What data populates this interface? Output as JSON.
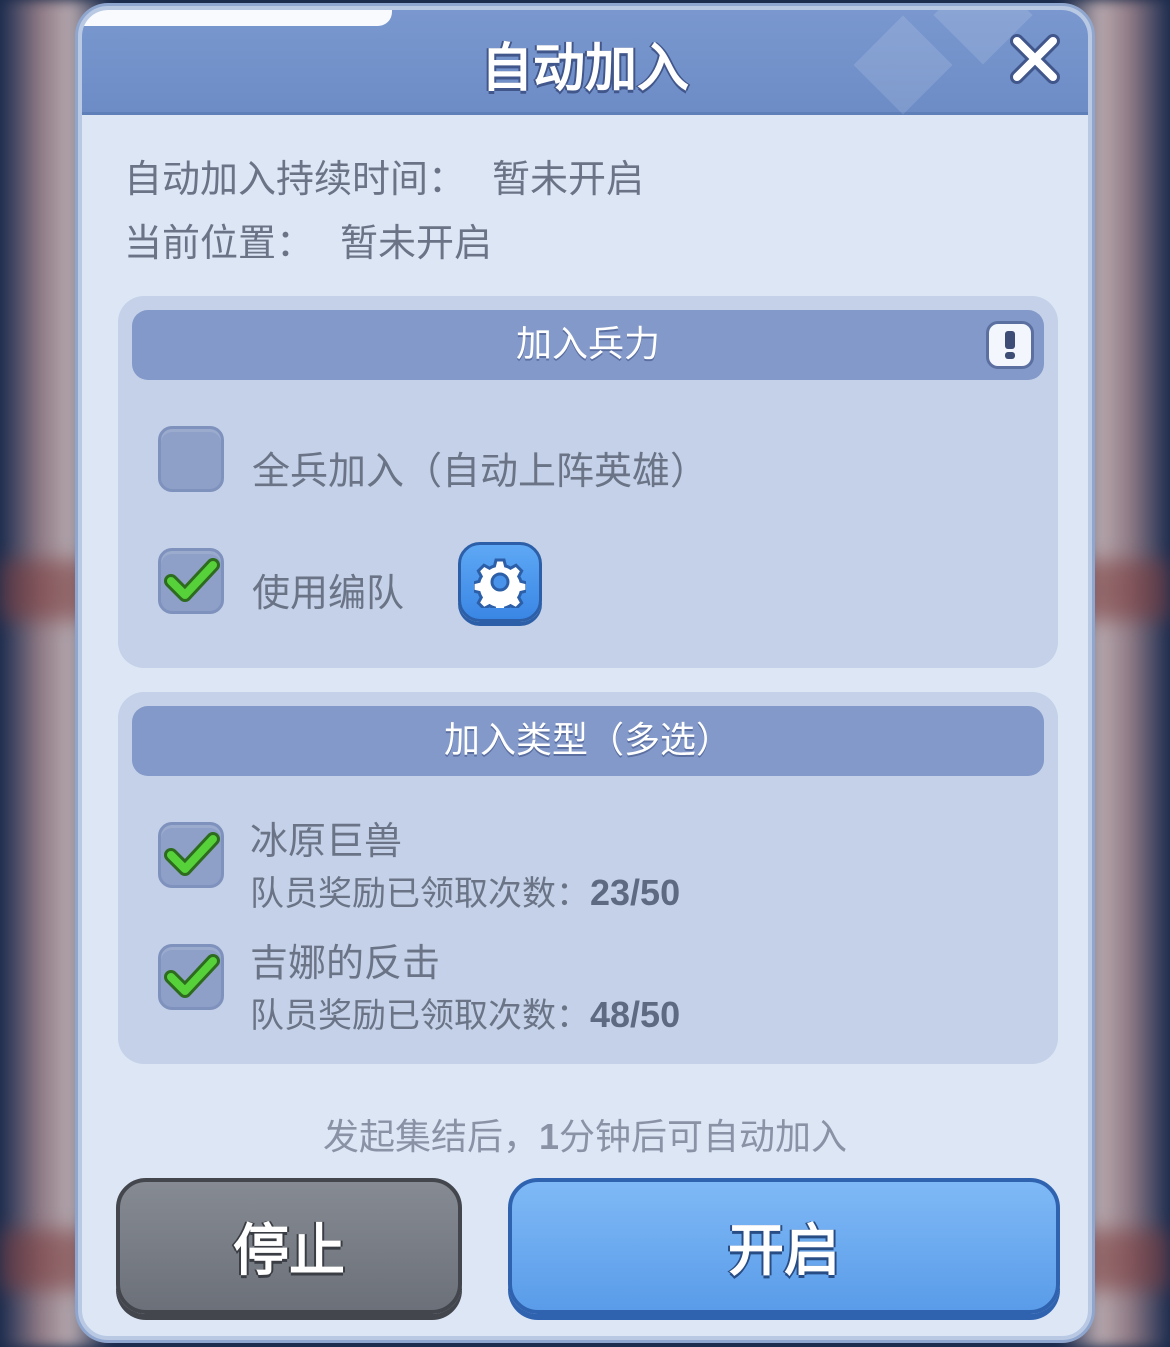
{
  "dialog": {
    "title": "自动加入",
    "close_icon": "close-icon"
  },
  "info": {
    "duration_label": "自动加入持续时间：",
    "duration_value": "暂未开启",
    "position_label": "当前位置：",
    "position_value": "暂未开启"
  },
  "troops_panel": {
    "header": "加入兵力",
    "options": [
      {
        "label": "全兵加入（自动上阵英雄）",
        "checked": false
      },
      {
        "label": "使用编队",
        "checked": true
      }
    ]
  },
  "types_panel": {
    "header": "加入类型（多选）",
    "items": [
      {
        "name": "冰原巨兽",
        "reward_label": "队员奖励已领取次数：",
        "reward_value": "23/50",
        "checked": true
      },
      {
        "name": "吉娜的反击",
        "reward_label": "队员奖励已领取次数：",
        "reward_value": "48/50",
        "checked": true
      }
    ]
  },
  "hint": {
    "text_before": "发起集结后，",
    "number": "1",
    "text_after": "分钟后可自动加入"
  },
  "buttons": {
    "stop_label": "停止",
    "start_label": "开启"
  },
  "colors": {
    "title_bar": "#6d8cc6",
    "panel": "#c4d1e8",
    "check_green": "#4cc233",
    "start_button": "#5a9ce9",
    "stop_button": "#6b7079"
  }
}
